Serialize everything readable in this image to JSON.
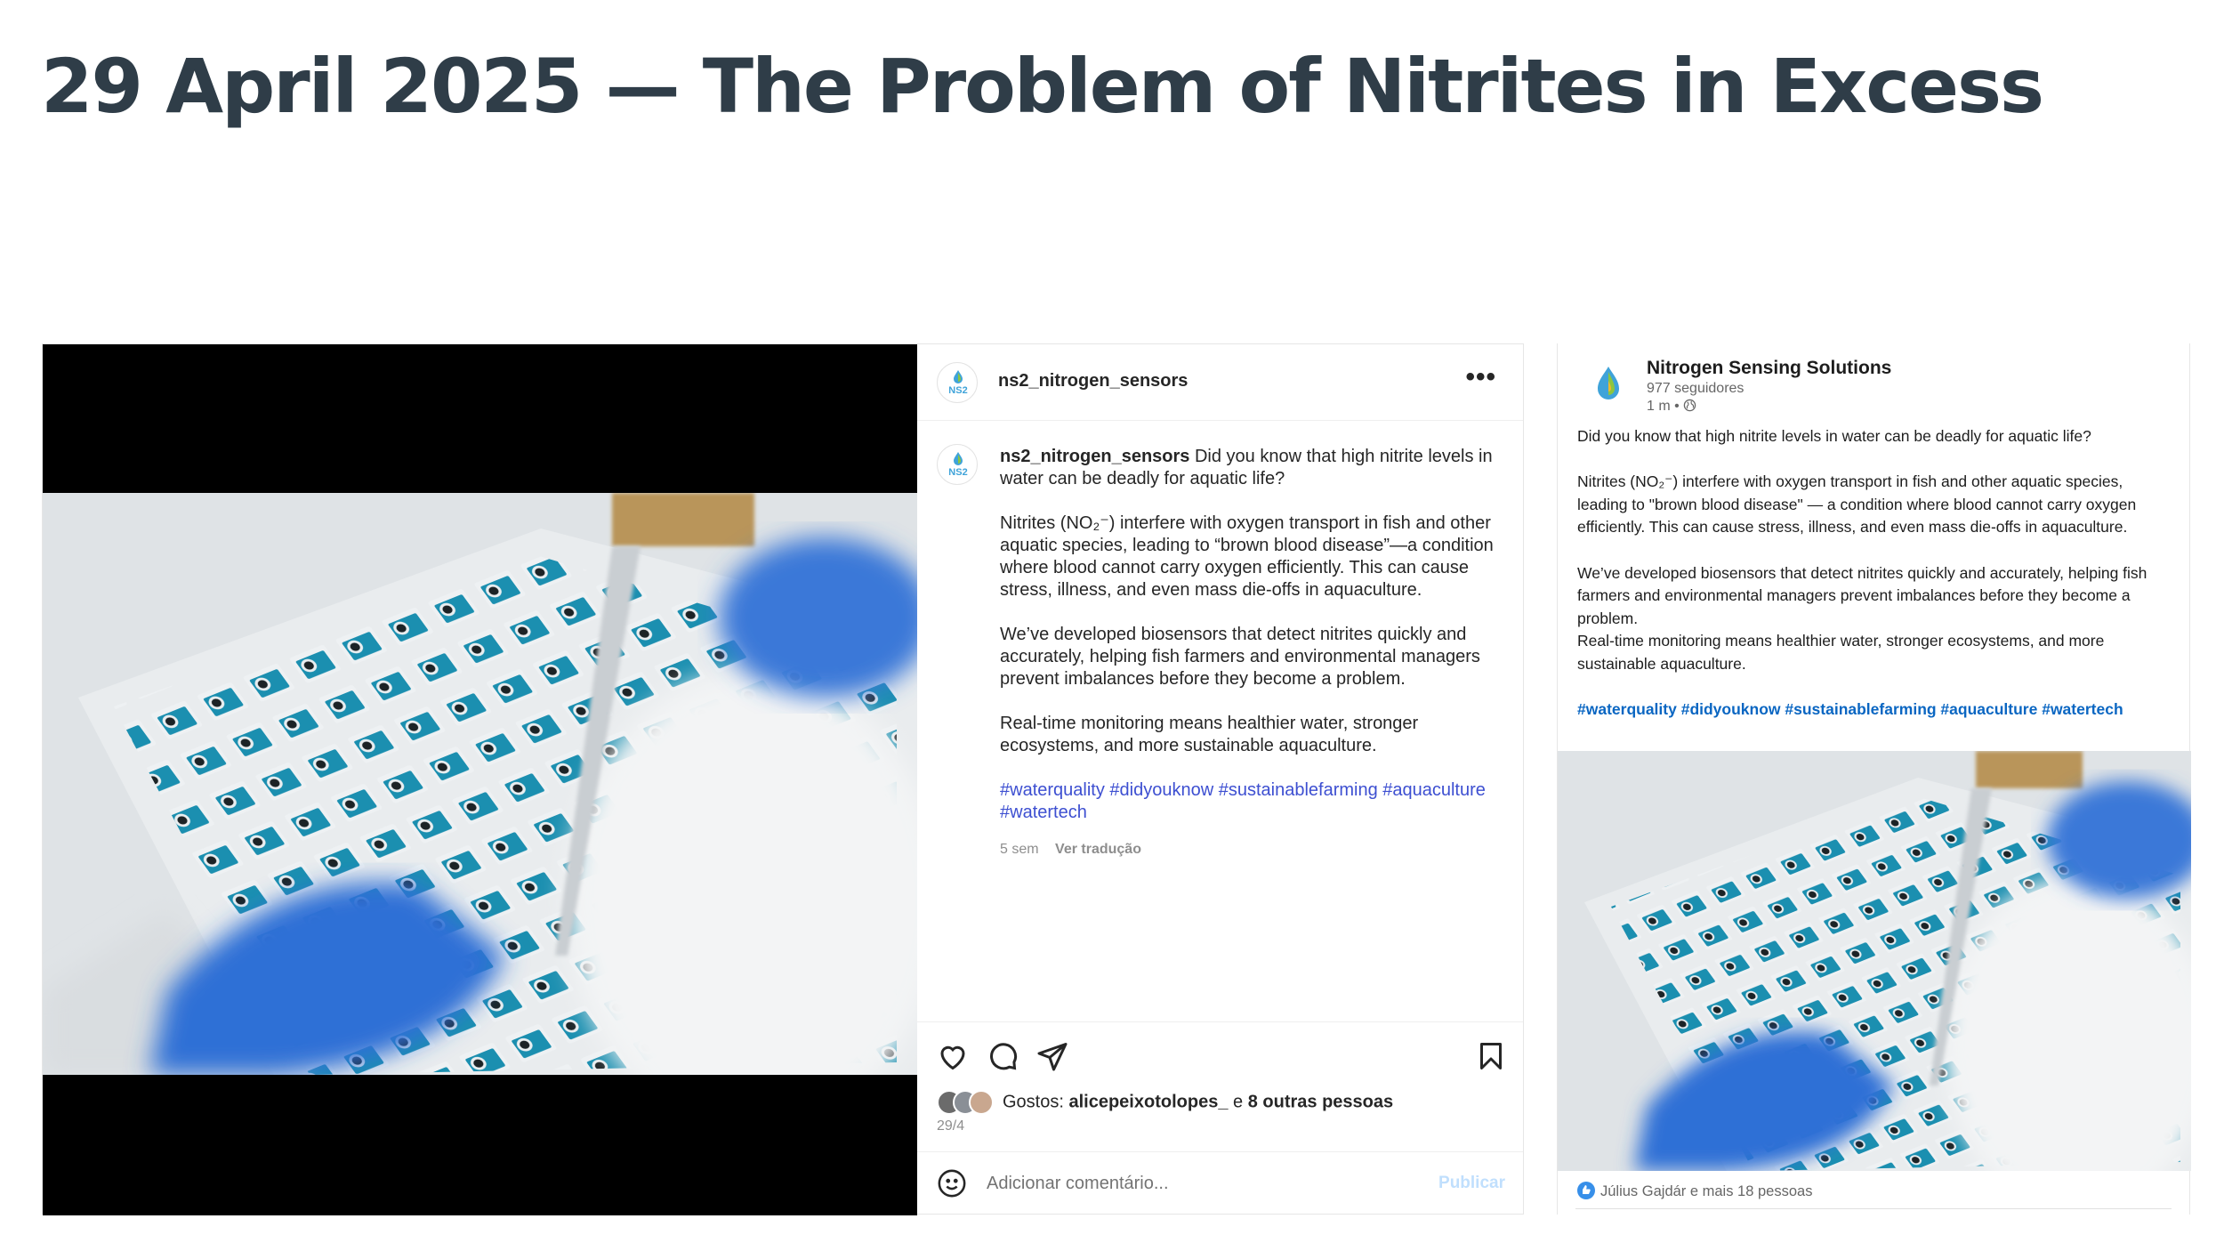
{
  "page": {
    "title": "29 April 2025 — The Problem of Nitrites in Excess"
  },
  "instagram": {
    "username": "ns2_nitrogen_sensors",
    "avatar_text": "NS2",
    "more_icon": "more-horizontal-icon",
    "caption": {
      "username": "ns2_nitrogen_sensors",
      "intro": "Did you know that high nitrite levels in water can be deadly for aquatic life?",
      "p2": "Nitrites (NO₂⁻) interfere with oxygen transport in fish and other aquatic species, leading to “brown blood disease”—a condition where blood cannot carry oxygen efficiently. This can cause stress, illness, and even mass die-offs in aquaculture.",
      "p3": "We’ve developed biosensors that detect nitrites quickly and accurately, helping fish farmers and environmental managers prevent imbalances before they become a problem.",
      "p4": "Real-time monitoring means healthier water, stronger ecosystems, and more sustainable aquaculture.",
      "hashtags": "#waterquality #didyouknow #sustainablefarming #aquaculture #watertech",
      "age": "5 sem",
      "translate": "Ver tradução"
    },
    "likes": {
      "prefix": "Gostos: ",
      "user": "alicepeixotolopes_",
      "connector": " e ",
      "others": "8 outras pessoas"
    },
    "date": "29/4",
    "comment_placeholder": "Adicionar comentário...",
    "publish_label": "Publicar",
    "icons": [
      "heart-icon",
      "comment-icon",
      "share-icon",
      "bookmark-icon",
      "emoji-icon"
    ]
  },
  "linkedin": {
    "company": "Nitrogen Sensing Solutions",
    "followers": "977 seguidores",
    "time": "1 m •",
    "p1": "Did you know that high nitrite levels in water can be deadly for aquatic life?",
    "p2": "Nitrites (NO₂⁻) interfere with oxygen transport in fish and other aquatic species, leading to \"brown blood disease\" — a condition where blood cannot carry oxygen efficiently. This can cause stress, illness, and even mass die-offs in aquaculture.",
    "p3": "We’ve developed biosensors that detect nitrites quickly and accurately, helping fish farmers and environmental managers prevent imbalances before they become a problem.",
    "p4": "Real-time monitoring means healthier water, stronger ecosystems, and more sustainable aquaculture.",
    "hashtags": "#waterquality #didyouknow #sustainablefarming #aquaculture #watertech",
    "reactions": "Július Gajdár e mais 18 pessoas"
  },
  "colors": {
    "title": "#2f3d48",
    "ig_hashtag": "#3d4fd1",
    "li_hashtag": "#0a66c2",
    "sensor_blue": "#1b8fb0",
    "glove_blue": "#2f6fd6"
  }
}
